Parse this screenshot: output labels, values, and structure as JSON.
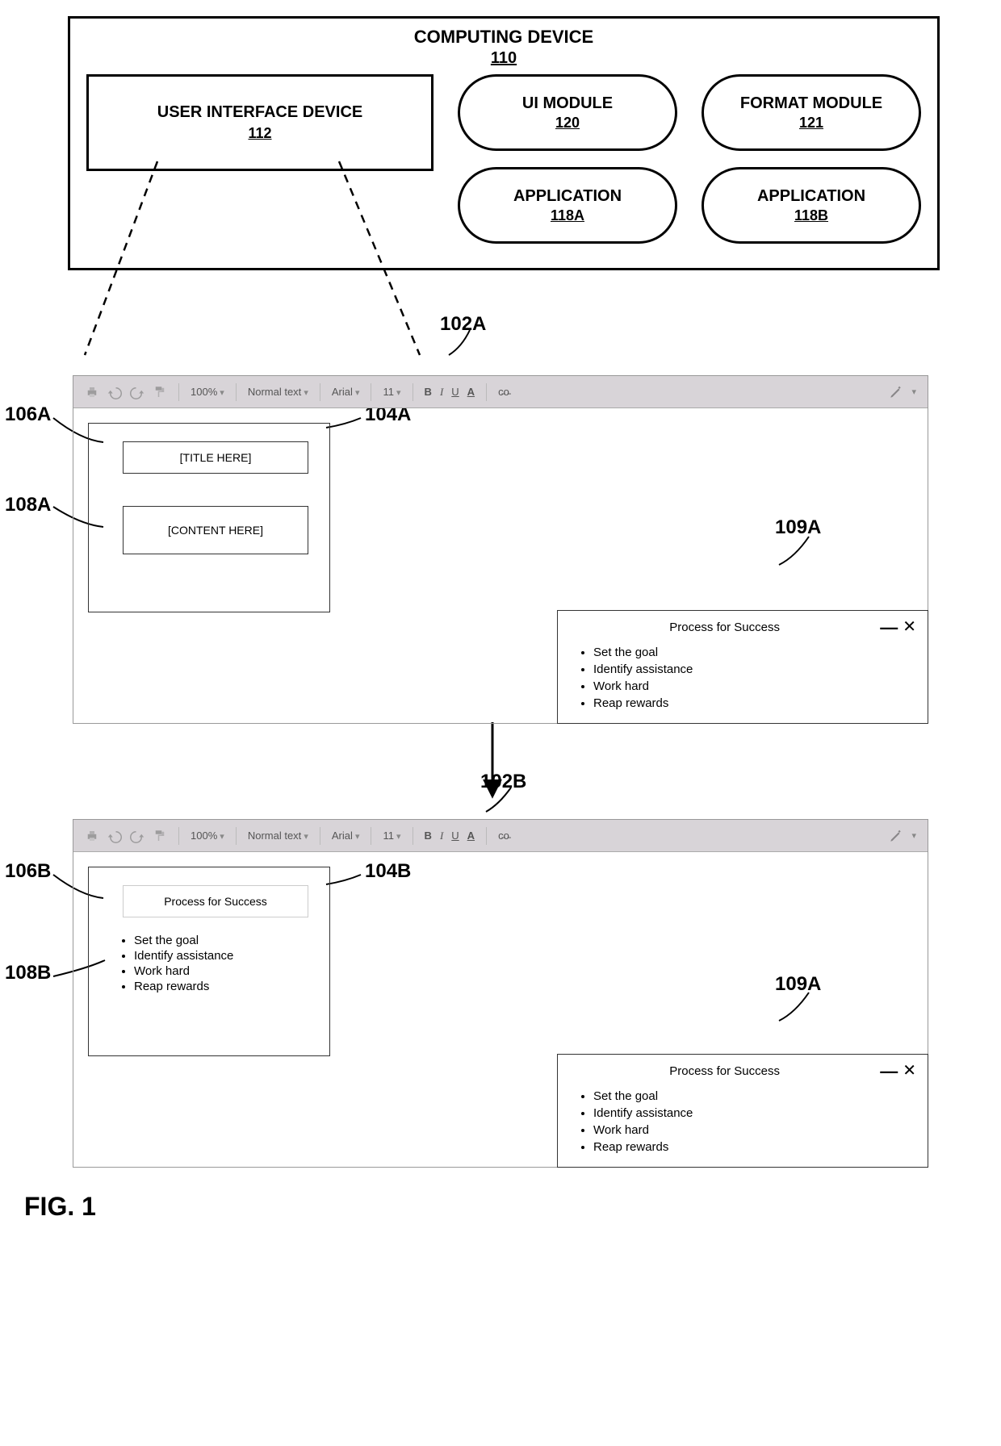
{
  "device": {
    "title": "COMPUTING DEVICE",
    "ref": "110",
    "uid": {
      "title": "USER INTERFACE DEVICE",
      "ref": "112"
    },
    "modules": {
      "ui": {
        "title": "UI MODULE",
        "ref": "120"
      },
      "format": {
        "title": "FORMAT MODULE",
        "ref": "121"
      },
      "appA": {
        "title": "APPLICATION",
        "ref": "118A"
      },
      "appB": {
        "title": "APPLICATION",
        "ref": "118B"
      }
    }
  },
  "toolbar": {
    "zoom": "100%",
    "style": "Normal text",
    "font": "Arial",
    "size": "11",
    "bold": "B",
    "italic": "I",
    "underline": "U",
    "textcolor": "A",
    "link": "c̵o̵"
  },
  "editorA": {
    "ref_window": "102A",
    "ref_page": "104A",
    "ref_title": "106A",
    "ref_content": "108A",
    "title_placeholder": "[TITLE HERE]",
    "content_placeholder": "[CONTENT HERE]"
  },
  "editorB": {
    "ref_window": "102B",
    "ref_page": "104B",
    "ref_title": "106B",
    "ref_content": "108B",
    "title_text": "Process for Success",
    "items": [
      "Set the goal",
      "Identify assistance",
      "Work hard",
      "Reap rewards"
    ]
  },
  "popup": {
    "ref": "109A",
    "title": "Process for Success",
    "items": [
      "Set the goal",
      "Identify assistance",
      "Work hard",
      "Reap rewards"
    ]
  },
  "figure_label": "FIG. 1"
}
